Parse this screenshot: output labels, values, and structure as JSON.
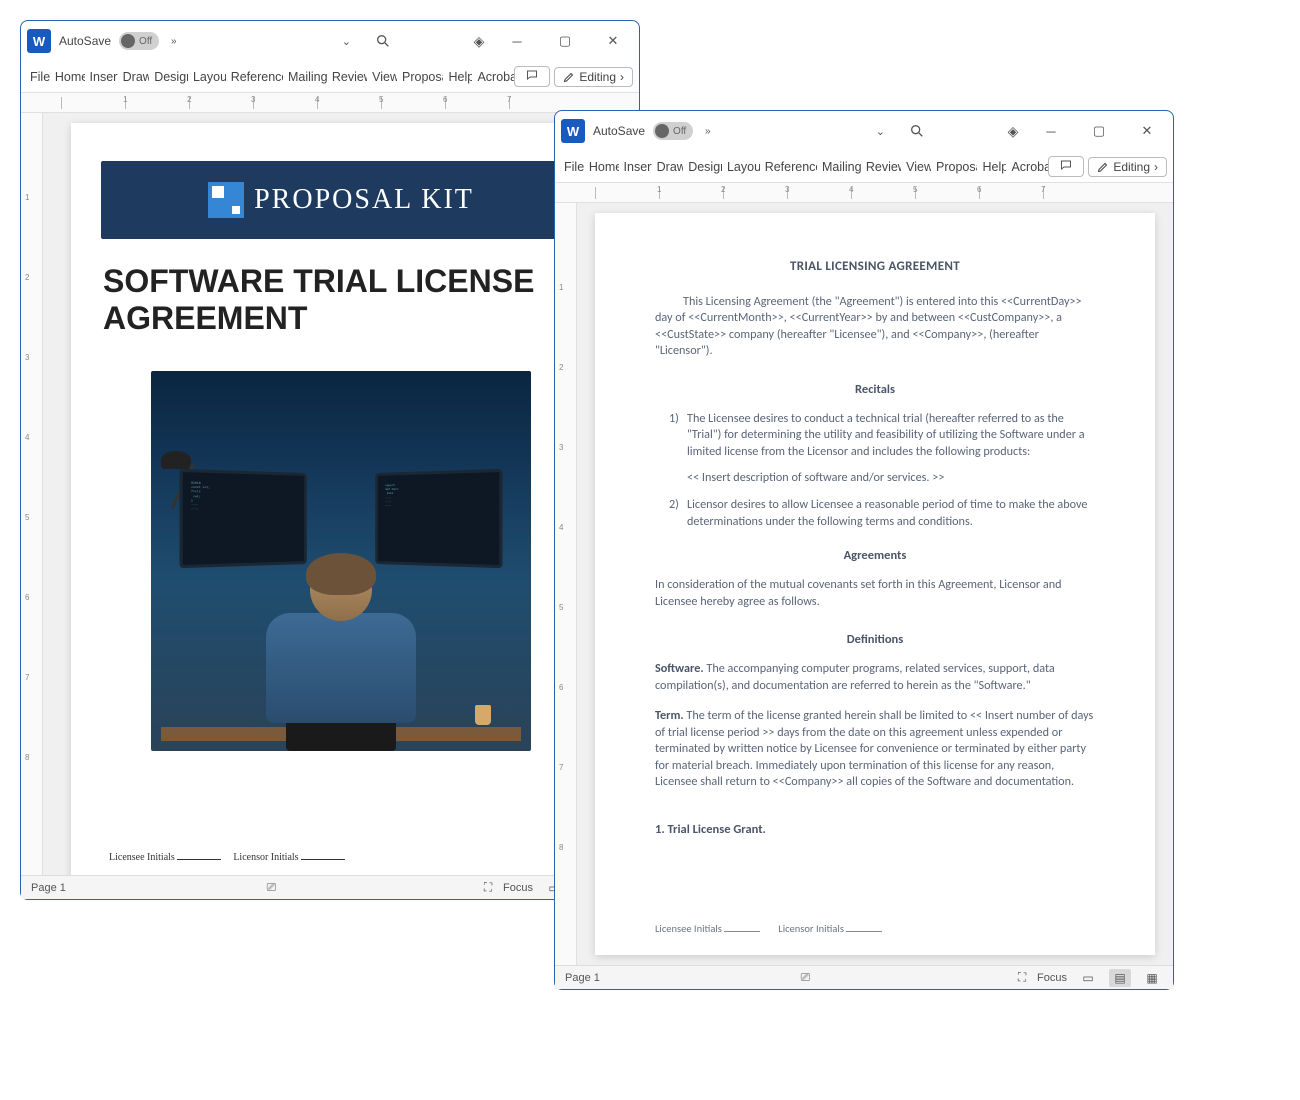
{
  "common": {
    "autosave_label": "AutoSave",
    "autosave_state": "Off",
    "menu_tabs": [
      "File",
      "Home",
      "Insert",
      "Draw",
      "Design",
      "Layout",
      "References",
      "Mailings",
      "Review",
      "View",
      "Proposal",
      "Help",
      "Acrobat"
    ],
    "editing_label": "Editing",
    "ruler_numbers": [
      "1",
      "2",
      "3",
      "4",
      "5",
      "6",
      "7"
    ],
    "vruler_numbers": [
      "1",
      "2",
      "3",
      "4",
      "5",
      "6",
      "7",
      "8"
    ],
    "page_label": "Page 1",
    "focus_label": "Focus"
  },
  "doc1": {
    "banner_text": "PROPOSAL KIT",
    "title_l1": "SOFTWARE TRIAL LICENSE",
    "title_l2": "AGREEMENT",
    "licensee": "Licensee Initials",
    "licensor": "Licensor Initials"
  },
  "doc2": {
    "title": "TRIAL LICENSING AGREEMENT",
    "intro": "This Licensing Agreement (the \"Agreement\") is entered into this <<CurrentDay>> day of <<CurrentMonth>>, <<CurrentYear>> by and between <<CustCompany>>, a <<CustState>> company (hereafter \"Licensee\"), and <<Company>>, (hereafter \"Licensor\").",
    "recitals_h": "Recitals",
    "r1": "The Licensee desires to conduct a technical trial (hereafter referred to as the \"Trial\") for determining the utility and feasibility of utilizing the Software under a limited license from the Licensor and includes the following products:",
    "r_insert": "<< Insert description of software and/or services. >>",
    "r2": "Licensor desires to allow Licensee a reasonable period of time to make the above determinations under the following terms and conditions.",
    "agreements_h": "Agreements",
    "agree_p": "In consideration of the mutual covenants set forth in this Agreement, Licensor and Licensee hereby agree as follows.",
    "defs_h": "Definitions",
    "def_sw_label": "Software.",
    "def_sw": " The accompanying computer programs, related services, support, data compilation(s), and documentation are referred to herein as the \"Software.\"",
    "def_term_label": "Term.",
    "def_term": " The term of the license granted herein shall be limited to << Insert number of days of trial license period >> days from the date on this agreement unless expended or terminated by written notice by Licensee for convenience or terminated by either party for material breach. Immediately upon termination of this license for any reason, Licensee shall return to <<Company>> all copies of the Software and documentation.",
    "sec1": "1. Trial License Grant.",
    "licensee": "Licensee Initials",
    "licensor": "Licensor Initials"
  }
}
